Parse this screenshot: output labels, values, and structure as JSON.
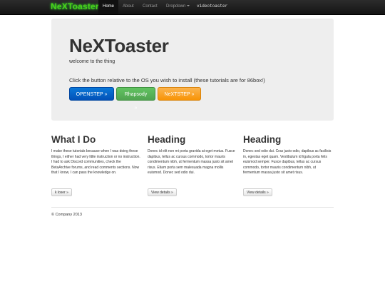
{
  "navbar": {
    "brand": "NeXToaster",
    "items": [
      {
        "label": "Home"
      },
      {
        "label": "About"
      },
      {
        "label": "Contact"
      },
      {
        "label": "Dropdown"
      },
      {
        "label": "videotoaster"
      }
    ]
  },
  "hero": {
    "title": "NeXToaster",
    "subtitle": "welcome to the thing",
    "description": "Click the button relative to the OS you wish to install (these tutorials are for 86box!)",
    "buttons": [
      {
        "label": "OPENSTEP »",
        "color": "#0251b8"
      },
      {
        "label": "Rhapsody »",
        "color": "#51a351"
      },
      {
        "label": "NeXTSTEP »",
        "color": "#f89406"
      }
    ]
  },
  "columns": [
    {
      "heading": "What I Do",
      "body": "I make these tutorials because when I was doing these things, I either had very little instruction or no instruction. I had to ask Discord communities, check the BetaArchive forums, and read comments sections. Now that I know, I can pass the knowledge on.",
      "button": "k loser »"
    },
    {
      "heading": "Heading",
      "body": "Donec id elit non mi porta gravida at eget metus. Fusce dapibus, tellus ac cursus commodo, tortor mauris condimentum nibh, ut fermentum massa justo sit amet risus. Etiam porta sem malesuada magna mollis euismod. Donec sed odio dui.",
      "button": "View details »"
    },
    {
      "heading": "Heading",
      "body": "Donec sed odio dui. Cras justo odio, dapibus ac facilisis in, egestas eget quam. Vestibulum id ligula porta felis euismod semper. Fusce dapibus, tellus ac cursus commodo, tortor mauris condimentum nibh, ut fermentum massa justo sit amet risus.",
      "button": "View details »"
    }
  ],
  "footer": {
    "copyright": "© Company 2013"
  }
}
